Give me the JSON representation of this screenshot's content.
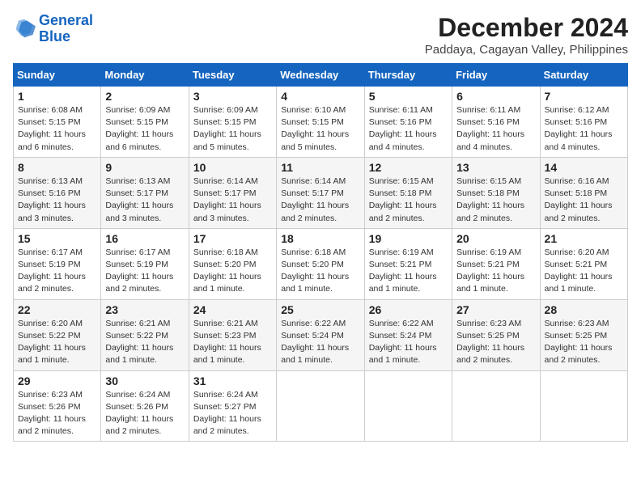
{
  "logo": {
    "line1": "General",
    "line2": "Blue"
  },
  "title": "December 2024",
  "subtitle": "Paddaya, Cagayan Valley, Philippines",
  "days_header": [
    "Sunday",
    "Monday",
    "Tuesday",
    "Wednesday",
    "Thursday",
    "Friday",
    "Saturday"
  ],
  "weeks": [
    [
      {
        "day": "1",
        "sunrise": "6:08 AM",
        "sunset": "5:15 PM",
        "daylight": "11 hours and 6 minutes."
      },
      {
        "day": "2",
        "sunrise": "6:09 AM",
        "sunset": "5:15 PM",
        "daylight": "11 hours and 6 minutes."
      },
      {
        "day": "3",
        "sunrise": "6:09 AM",
        "sunset": "5:15 PM",
        "daylight": "11 hours and 5 minutes."
      },
      {
        "day": "4",
        "sunrise": "6:10 AM",
        "sunset": "5:15 PM",
        "daylight": "11 hours and 5 minutes."
      },
      {
        "day": "5",
        "sunrise": "6:11 AM",
        "sunset": "5:16 PM",
        "daylight": "11 hours and 4 minutes."
      },
      {
        "day": "6",
        "sunrise": "6:11 AM",
        "sunset": "5:16 PM",
        "daylight": "11 hours and 4 minutes."
      },
      {
        "day": "7",
        "sunrise": "6:12 AM",
        "sunset": "5:16 PM",
        "daylight": "11 hours and 4 minutes."
      }
    ],
    [
      {
        "day": "8",
        "sunrise": "6:13 AM",
        "sunset": "5:16 PM",
        "daylight": "11 hours and 3 minutes."
      },
      {
        "day": "9",
        "sunrise": "6:13 AM",
        "sunset": "5:17 PM",
        "daylight": "11 hours and 3 minutes."
      },
      {
        "day": "10",
        "sunrise": "6:14 AM",
        "sunset": "5:17 PM",
        "daylight": "11 hours and 3 minutes."
      },
      {
        "day": "11",
        "sunrise": "6:14 AM",
        "sunset": "5:17 PM",
        "daylight": "11 hours and 2 minutes."
      },
      {
        "day": "12",
        "sunrise": "6:15 AM",
        "sunset": "5:18 PM",
        "daylight": "11 hours and 2 minutes."
      },
      {
        "day": "13",
        "sunrise": "6:15 AM",
        "sunset": "5:18 PM",
        "daylight": "11 hours and 2 minutes."
      },
      {
        "day": "14",
        "sunrise": "6:16 AM",
        "sunset": "5:18 PM",
        "daylight": "11 hours and 2 minutes."
      }
    ],
    [
      {
        "day": "15",
        "sunrise": "6:17 AM",
        "sunset": "5:19 PM",
        "daylight": "11 hours and 2 minutes."
      },
      {
        "day": "16",
        "sunrise": "6:17 AM",
        "sunset": "5:19 PM",
        "daylight": "11 hours and 2 minutes."
      },
      {
        "day": "17",
        "sunrise": "6:18 AM",
        "sunset": "5:20 PM",
        "daylight": "11 hours and 1 minute."
      },
      {
        "day": "18",
        "sunrise": "6:18 AM",
        "sunset": "5:20 PM",
        "daylight": "11 hours and 1 minute."
      },
      {
        "day": "19",
        "sunrise": "6:19 AM",
        "sunset": "5:21 PM",
        "daylight": "11 hours and 1 minute."
      },
      {
        "day": "20",
        "sunrise": "6:19 AM",
        "sunset": "5:21 PM",
        "daylight": "11 hours and 1 minute."
      },
      {
        "day": "21",
        "sunrise": "6:20 AM",
        "sunset": "5:21 PM",
        "daylight": "11 hours and 1 minute."
      }
    ],
    [
      {
        "day": "22",
        "sunrise": "6:20 AM",
        "sunset": "5:22 PM",
        "daylight": "11 hours and 1 minute."
      },
      {
        "day": "23",
        "sunrise": "6:21 AM",
        "sunset": "5:22 PM",
        "daylight": "11 hours and 1 minute."
      },
      {
        "day": "24",
        "sunrise": "6:21 AM",
        "sunset": "5:23 PM",
        "daylight": "11 hours and 1 minute."
      },
      {
        "day": "25",
        "sunrise": "6:22 AM",
        "sunset": "5:24 PM",
        "daylight": "11 hours and 1 minute."
      },
      {
        "day": "26",
        "sunrise": "6:22 AM",
        "sunset": "5:24 PM",
        "daylight": "11 hours and 1 minute."
      },
      {
        "day": "27",
        "sunrise": "6:23 AM",
        "sunset": "5:25 PM",
        "daylight": "11 hours and 2 minutes."
      },
      {
        "day": "28",
        "sunrise": "6:23 AM",
        "sunset": "5:25 PM",
        "daylight": "11 hours and 2 minutes."
      }
    ],
    [
      {
        "day": "29",
        "sunrise": "6:23 AM",
        "sunset": "5:26 PM",
        "daylight": "11 hours and 2 minutes."
      },
      {
        "day": "30",
        "sunrise": "6:24 AM",
        "sunset": "5:26 PM",
        "daylight": "11 hours and 2 minutes."
      },
      {
        "day": "31",
        "sunrise": "6:24 AM",
        "sunset": "5:27 PM",
        "daylight": "11 hours and 2 minutes."
      },
      null,
      null,
      null,
      null
    ]
  ]
}
